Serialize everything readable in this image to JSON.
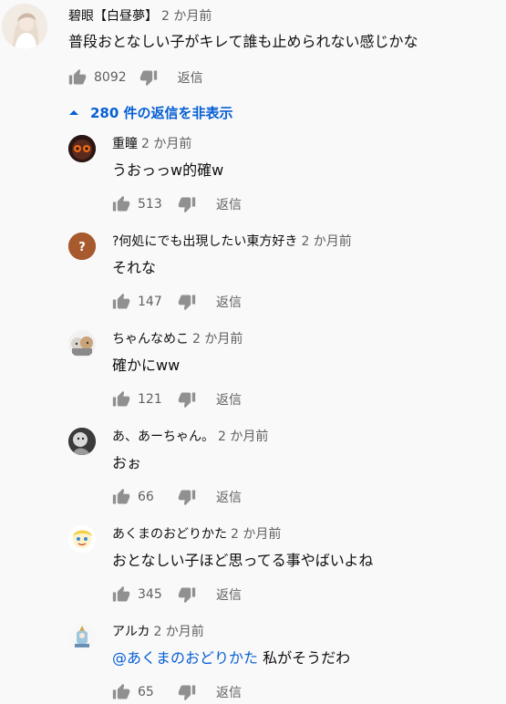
{
  "top_comment": {
    "author": "碧眼【白昼夢】",
    "time": "2 か月前",
    "text": "普段おとなしい子がキレて誰も止められない感じかな",
    "likes": "8092",
    "reply_label": "返信"
  },
  "replies_toggle": {
    "label": "280 件の返信を非表示"
  },
  "replies": [
    {
      "author": "重瞳",
      "time": "2 か月前",
      "text": "うおっっw的確w",
      "likes": "513",
      "reply_label": "返信"
    },
    {
      "author": "?何処にでも出現したい東方好き",
      "time": "2 か月前",
      "text": "それな",
      "likes": "147",
      "reply_label": "返信"
    },
    {
      "author": "ちゃんなめこ",
      "time": "2 か月前",
      "text": "確かにww",
      "likes": "121",
      "reply_label": "返信"
    },
    {
      "author": "あ、あーちゃん。",
      "time": "2 か月前",
      "text": "おぉ",
      "likes": "66",
      "reply_label": "返信"
    },
    {
      "author": "あくまのおどりかた",
      "time": "2 か月前",
      "text": "おとなしい子ほど思ってる事やばいよね",
      "likes": "345",
      "reply_label": "返信"
    },
    {
      "author": "アルカ",
      "time": "2 か月前",
      "mention": "@あくまのおどりかた",
      "text": "私がそうだわ",
      "likes": "65",
      "reply_label": "返信"
    }
  ],
  "colors": {
    "background": "#f9f9f9",
    "link_blue": "#065fd4",
    "meta_gray": "#606060",
    "icon_gray": "#909090"
  },
  "icons": {
    "like": "thumbs-up-icon",
    "dislike": "thumbs-down-icon",
    "toggle": "caret-up-icon"
  }
}
